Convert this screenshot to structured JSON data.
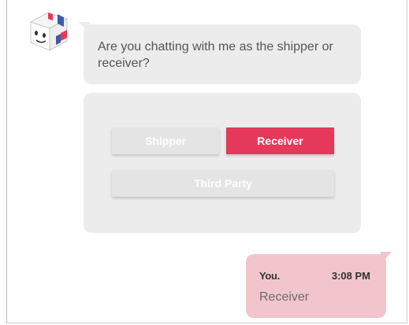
{
  "colors": {
    "selected": "#e4395a",
    "neutral_button": "#e4e4e4",
    "bubble_bg": "#ececec",
    "user_bubble_bg": "#f2c5cc"
  },
  "bot": {
    "avatar_icon": "box-mascot-icon",
    "message": "Are you chatting with me as the shipper or receiver?"
  },
  "options": [
    {
      "label": "Shipper",
      "selected": false
    },
    {
      "label": "Receiver",
      "selected": true
    },
    {
      "label": "Third Party",
      "selected": false
    }
  ],
  "user_message": {
    "sender": "You.",
    "time": "3:08 PM",
    "text": "Receiver"
  }
}
